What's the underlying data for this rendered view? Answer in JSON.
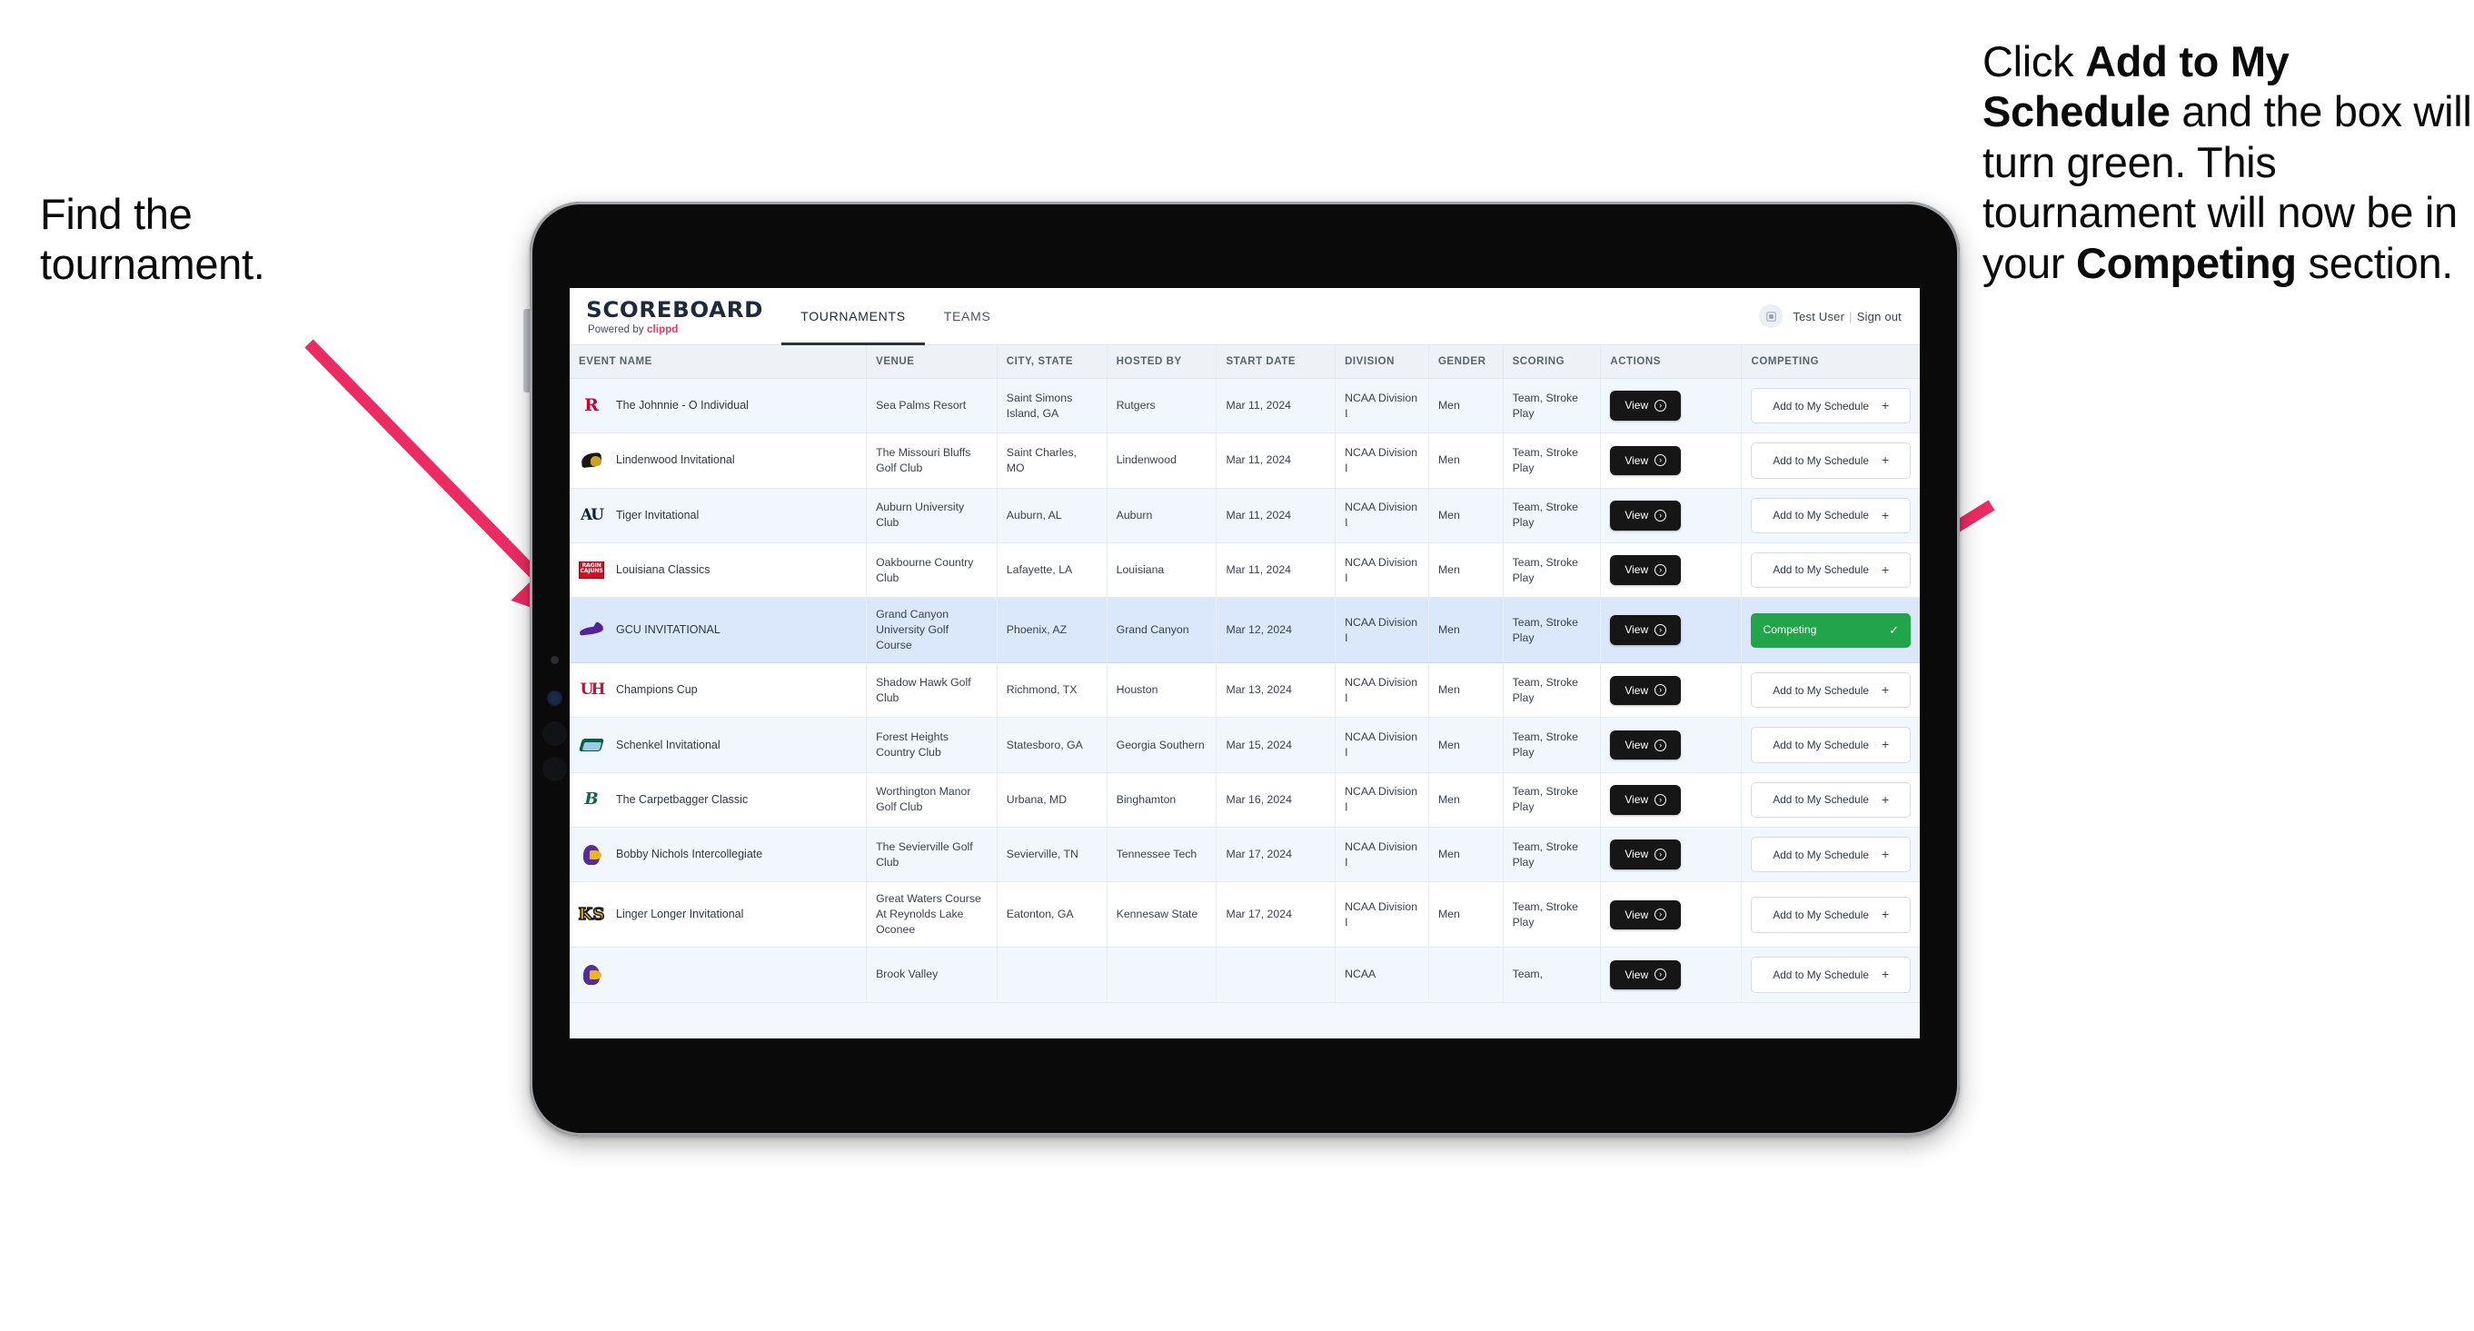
{
  "annotations": {
    "left": "Find the tournament.",
    "right_parts": [
      {
        "t": "Click ",
        "b": false
      },
      {
        "t": "Add to My Schedule",
        "b": true
      },
      {
        "t": " and the box will turn green. This tournament will now be in your ",
        "b": false
      },
      {
        "t": "Competing",
        "b": true
      },
      {
        "t": " section.",
        "b": false
      }
    ],
    "arrow_color": "#ec2b63"
  },
  "app": {
    "brand_name": "SCOREBOARD",
    "brand_sub_prefix": "Powered by ",
    "brand_sub_accent": "clippd",
    "tabs": [
      {
        "label": "TOURNAMENTS",
        "active": true
      },
      {
        "label": "TEAMS",
        "active": false
      }
    ],
    "user": {
      "avatar_icon": "user-avatar-icon",
      "name": "Test User",
      "separator": "|",
      "signout": "Sign out"
    }
  },
  "table": {
    "columns": [
      "EVENT NAME",
      "VENUE",
      "CITY, STATE",
      "HOSTED BY",
      "START DATE",
      "DIVISION",
      "GENDER",
      "SCORING",
      "ACTIONS",
      "COMPETING"
    ],
    "view_label": "View",
    "add_label": "Add to My Schedule",
    "add_plus": "+",
    "competing_label": "Competing",
    "competing_check": "✓",
    "rows": [
      {
        "logo": "rutgers",
        "event": "The Johnnie - O Individual",
        "venue": "Sea Palms Resort",
        "city": "Saint Simons Island, GA",
        "host": "Rutgers",
        "date": "Mar 11, 2024",
        "division": "NCAA Division I",
        "gender": "Men",
        "scoring": "Team, Stroke Play",
        "competing": false
      },
      {
        "logo": "lindenwood",
        "event": "Lindenwood Invitational",
        "venue": "The Missouri Bluffs Golf Club",
        "city": "Saint Charles, MO",
        "host": "Lindenwood",
        "date": "Mar 11, 2024",
        "division": "NCAA Division I",
        "gender": "Men",
        "scoring": "Team, Stroke Play",
        "competing": false
      },
      {
        "logo": "auburn",
        "event": "Tiger Invitational",
        "venue": "Auburn University Club",
        "city": "Auburn, AL",
        "host": "Auburn",
        "date": "Mar 11, 2024",
        "division": "NCAA Division I",
        "gender": "Men",
        "scoring": "Team, Stroke Play",
        "competing": false
      },
      {
        "logo": "louisiana",
        "event": "Louisiana Classics",
        "venue": "Oakbourne Country Club",
        "city": "Lafayette, LA",
        "host": "Louisiana",
        "date": "Mar 11, 2024",
        "division": "NCAA Division I",
        "gender": "Men",
        "scoring": "Team, Stroke Play",
        "competing": false
      },
      {
        "logo": "gcu",
        "event": "GCU INVITATIONAL",
        "venue": "Grand Canyon University Golf Course",
        "city": "Phoenix, AZ",
        "host": "Grand Canyon",
        "date": "Mar 12, 2024",
        "division": "NCAA Division I",
        "gender": "Men",
        "scoring": "Team, Stroke Play",
        "competing": true
      },
      {
        "logo": "houston",
        "event": "Champions Cup",
        "venue": "Shadow Hawk Golf Club",
        "city": "Richmond, TX",
        "host": "Houston",
        "date": "Mar 13, 2024",
        "division": "NCAA Division I",
        "gender": "Men",
        "scoring": "Team, Stroke Play",
        "competing": false
      },
      {
        "logo": "georgiasouthern",
        "event": "Schenkel Invitational",
        "venue": "Forest Heights Country Club",
        "city": "Statesboro, GA",
        "host": "Georgia Southern",
        "date": "Mar 15, 2024",
        "division": "NCAA Division I",
        "gender": "Men",
        "scoring": "Team, Stroke Play",
        "competing": false
      },
      {
        "logo": "binghamton",
        "event": "The Carpetbagger Classic",
        "venue": "Worthington Manor Golf Club",
        "city": "Urbana, MD",
        "host": "Binghamton",
        "date": "Mar 16, 2024",
        "division": "NCAA Division I",
        "gender": "Men",
        "scoring": "Team, Stroke Play",
        "competing": false
      },
      {
        "logo": "tennesseetech",
        "event": "Bobby Nichols Intercollegiate",
        "venue": "The Sevierville Golf Club",
        "city": "Sevierville, TN",
        "host": "Tennessee Tech",
        "date": "Mar 17, 2024",
        "division": "NCAA Division I",
        "gender": "Men",
        "scoring": "Team, Stroke Play",
        "competing": false
      },
      {
        "logo": "kennesaw",
        "event": "Linger Longer Invitational",
        "venue": "Great Waters Course At Reynolds Lake Oconee",
        "city": "Eatonton, GA",
        "host": "Kennesaw State",
        "date": "Mar 17, 2024",
        "division": "NCAA Division I",
        "gender": "Men",
        "scoring": "Team, Stroke Play",
        "competing": false
      },
      {
        "logo": "tennesseetech",
        "event": "",
        "venue": "Brook Valley",
        "city": "",
        "host": "",
        "date": "",
        "division": "NCAA",
        "gender": "",
        "scoring": "Team,",
        "competing": false,
        "cut": true
      }
    ]
  }
}
